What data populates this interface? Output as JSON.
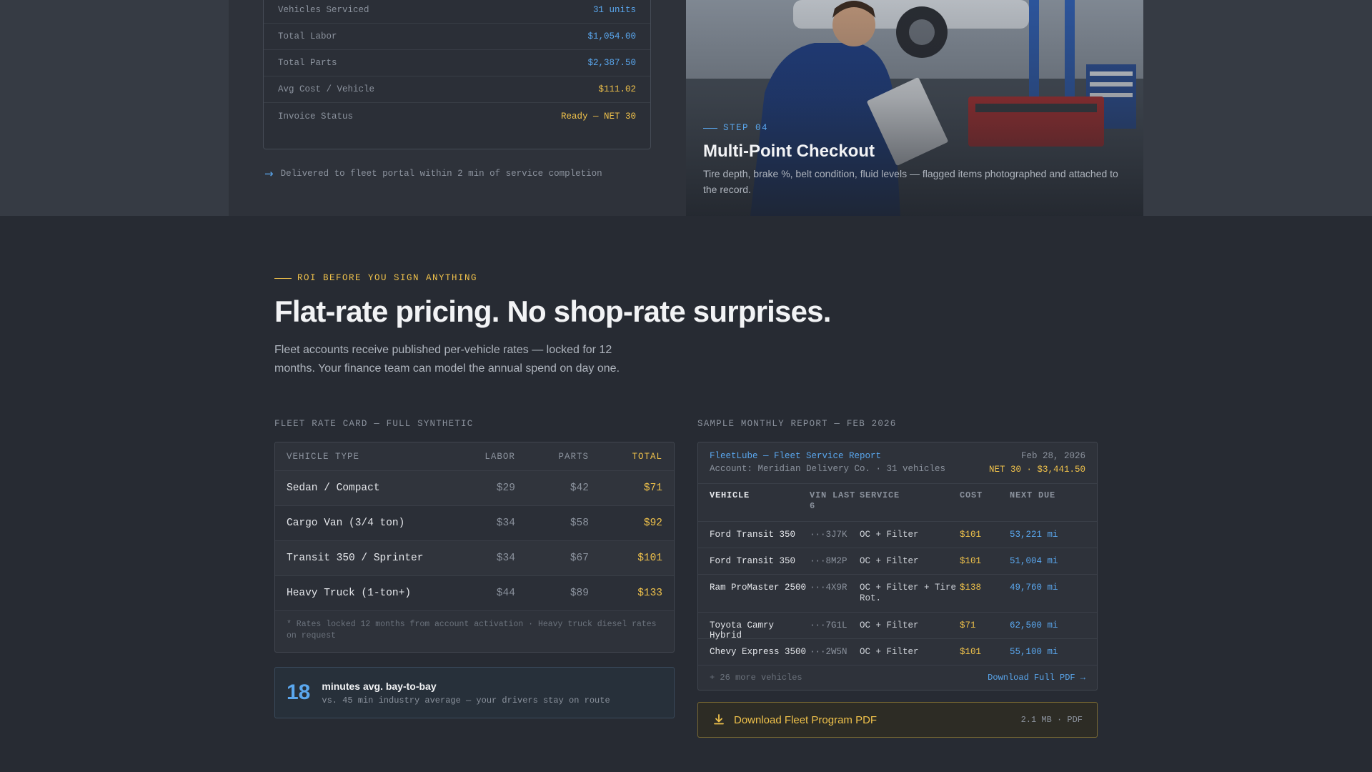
{
  "summary": {
    "rows": [
      {
        "label": "Vehicles Serviced",
        "value": "31 units",
        "color": "blue"
      },
      {
        "label": "Total Labor",
        "value": "$1,054.00",
        "color": "blue"
      },
      {
        "label": "Total Parts",
        "value": "$2,387.50",
        "color": "blue"
      },
      {
        "label": "Avg Cost / Vehicle",
        "value": "$111.02",
        "color": "gold"
      },
      {
        "label": "Invoice Status",
        "value": "Ready — NET 30",
        "color": "gold"
      }
    ],
    "delivered_note": "Delivered to fleet portal within 2 min of service completion"
  },
  "step": {
    "label": "STEP 04",
    "title": "Multi-Point Checkout",
    "description": "Tire depth, brake %, belt condition, fluid levels — flagged items photographed and attached to the record."
  },
  "roi": {
    "eyebrow": "ROI BEFORE YOU SIGN ANYTHING",
    "headline": "Flat-rate pricing. No shop-rate surprises.",
    "lead": "Fleet accounts receive published per-vehicle rates — locked for 12 months. Your finance team can model the annual spend on day one."
  },
  "rate_card": {
    "label": "FLEET RATE CARD — FULL SYNTHETIC",
    "headers": {
      "type": "VEHICLE TYPE",
      "labor": "LABOR",
      "parts": "PARTS",
      "total": "TOTAL"
    },
    "rows": [
      {
        "type": "Sedan / Compact",
        "labor": "$29",
        "parts": "$42",
        "total": "$71"
      },
      {
        "type": "Cargo Van (3/4 ton)",
        "labor": "$34",
        "parts": "$58",
        "total": "$92"
      },
      {
        "type": "Transit 350 / Sprinter",
        "labor": "$34",
        "parts": "$67",
        "total": "$101"
      },
      {
        "type": "Heavy Truck (1-ton+)",
        "labor": "$44",
        "parts": "$89",
        "total": "$133"
      }
    ],
    "note": "* Rates locked 12 months from account activation · Heavy truck diesel rates on request"
  },
  "metric": {
    "number": "18",
    "title": "minutes avg. bay-to-bay",
    "subtitle": "vs. 45 min industry average — your drivers stay on route"
  },
  "report": {
    "label": "SAMPLE MONTHLY REPORT — FEB 2026",
    "title": "FleetLube — Fleet Service Report",
    "account": "Account: Meridian Delivery Co. · 31 vehicles",
    "date": "Feb 28, 2026",
    "total": "NET 30 · $3,441.50",
    "headers": {
      "vehicle": "VEHICLE",
      "vin": "VIN LAST 6",
      "service": "SERVICE",
      "cost": "COST",
      "next_due": "NEXT DUE"
    },
    "rows": [
      {
        "vehicle": "Ford Transit 350",
        "vin": "···3J7K",
        "service": "OC + Filter",
        "cost": "$101",
        "next_due": "53,221 mi"
      },
      {
        "vehicle": "Ford Transit 350",
        "vin": "···8M2P",
        "service": "OC + Filter",
        "cost": "$101",
        "next_due": "51,004 mi"
      },
      {
        "vehicle": "Ram ProMaster 2500",
        "vin": "···4X9R",
        "service": "OC + Filter + Tire Rot.",
        "cost": "$138",
        "next_due": "49,760 mi"
      },
      {
        "vehicle": "Toyota Camry Hybrid",
        "vin": "···7G1L",
        "service": "OC + Filter",
        "cost": "$71",
        "next_due": "62,500 mi"
      },
      {
        "vehicle": "Chevy Express 3500",
        "vin": "···2W5N",
        "service": "OC + Filter",
        "cost": "$101",
        "next_due": "55,100 mi"
      }
    ],
    "more": "+ 26 more vehicles",
    "download_link": "Download Full PDF →"
  },
  "download_button": {
    "label": "Download Fleet Program PDF",
    "meta": "2.1 MB · PDF",
    "icon": "download-icon"
  },
  "colors": {
    "blue": "#5aa7ee",
    "gold": "#f0c24b",
    "background": "#272b33"
  }
}
